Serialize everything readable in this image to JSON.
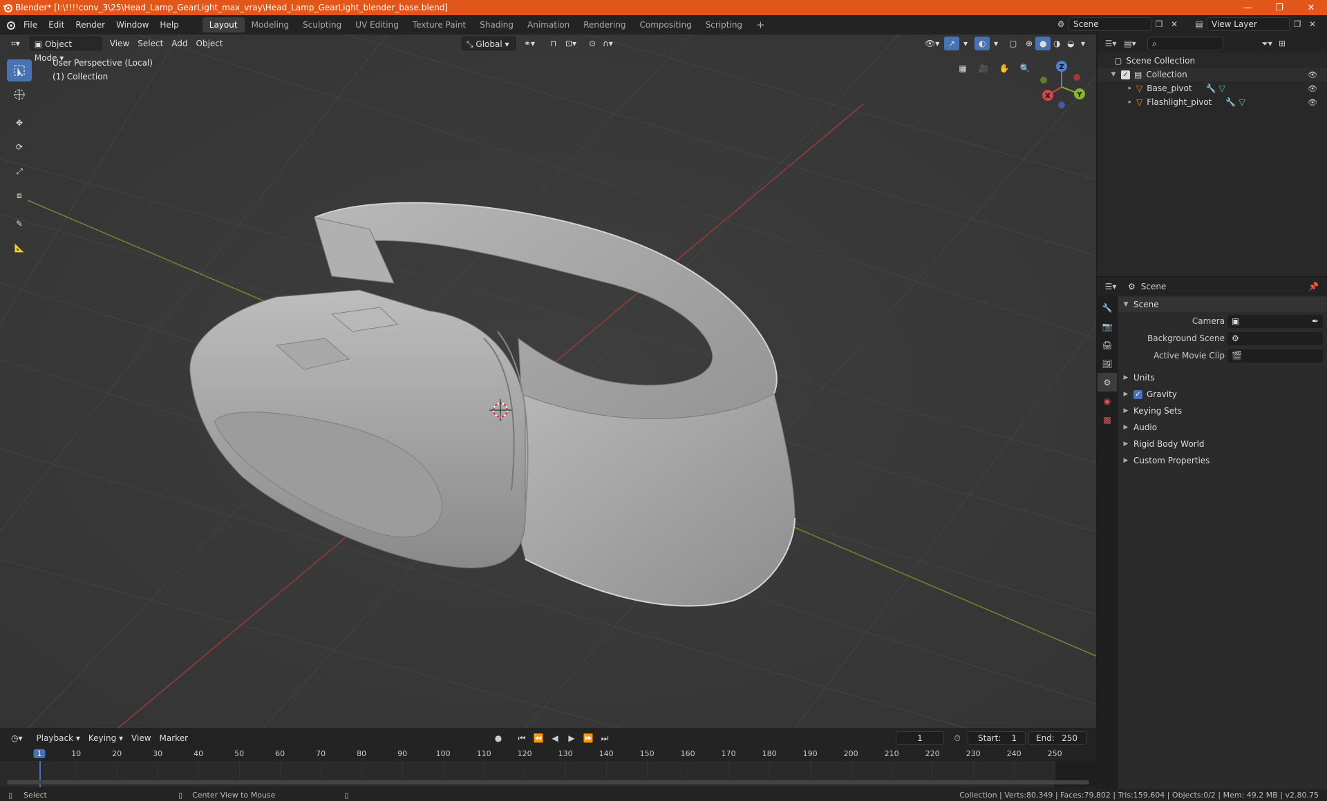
{
  "window": {
    "title": "Blender* [I:\\!!!!conv_3\\25\\Head_Lamp_GearLight_max_vray\\Head_Lamp_GearLight_blender_base.blend]",
    "minimize": "—",
    "maximize": "❐",
    "close": "✕"
  },
  "menu": {
    "items": [
      "File",
      "Edit",
      "Render",
      "Window",
      "Help"
    ]
  },
  "workspaces": {
    "tabs": [
      "Layout",
      "Modeling",
      "Sculpting",
      "UV Editing",
      "Texture Paint",
      "Shading",
      "Animation",
      "Rendering",
      "Compositing",
      "Scripting"
    ],
    "add": "+"
  },
  "scene_selector": {
    "value": "Scene"
  },
  "viewlayer_selector": {
    "value": "View Layer"
  },
  "viewport": {
    "mode": "Object Mode",
    "menus": [
      "View",
      "Select",
      "Add",
      "Object"
    ],
    "transform_orientation": "Global",
    "info_line1": "User Perspective (Local)",
    "info_line2": "(1) Collection",
    "gizmo": {
      "x": "X",
      "y": "Y",
      "z": "Z"
    }
  },
  "outliner": {
    "search_placeholder": "",
    "root": "Scene Collection",
    "collection": "Collection",
    "objects": [
      "Base_pivot",
      "Flashlight_pivot"
    ]
  },
  "properties": {
    "context": "Scene",
    "panel_title": "Scene",
    "fields": [
      {
        "label": "Camera",
        "value": ""
      },
      {
        "label": "Background Scene",
        "value": ""
      },
      {
        "label": "Active Movie Clip",
        "value": ""
      }
    ],
    "sections": [
      "Units",
      "Gravity",
      "Keying Sets",
      "Audio",
      "Rigid Body World",
      "Custom Properties"
    ]
  },
  "timeline": {
    "menus": [
      "Playback",
      "Keying",
      "View",
      "Marker"
    ],
    "current_frame": "1",
    "start_label": "Start:",
    "start": "1",
    "end_label": "End:",
    "end": "250",
    "ticks": [
      "1",
      "10",
      "20",
      "30",
      "40",
      "50",
      "60",
      "70",
      "80",
      "90",
      "100",
      "110",
      "120",
      "130",
      "140",
      "150",
      "160",
      "170",
      "180",
      "190",
      "200",
      "210",
      "220",
      "230",
      "240",
      "250"
    ]
  },
  "status": {
    "left_action": "Select",
    "middle_action": "Center View to Mouse",
    "stats": "Collection | Verts:80,349 | Faces:79,802 | Tris:159,604 | Objects:0/2 | Mem: 49.2 MB | v2.80.75"
  },
  "colors": {
    "titlebar": "#e2561a",
    "accent": "#4772b3",
    "viewport_bg": "#393939",
    "x_axis": "#9a3a3a",
    "y_axis": "#6a8c2a"
  }
}
